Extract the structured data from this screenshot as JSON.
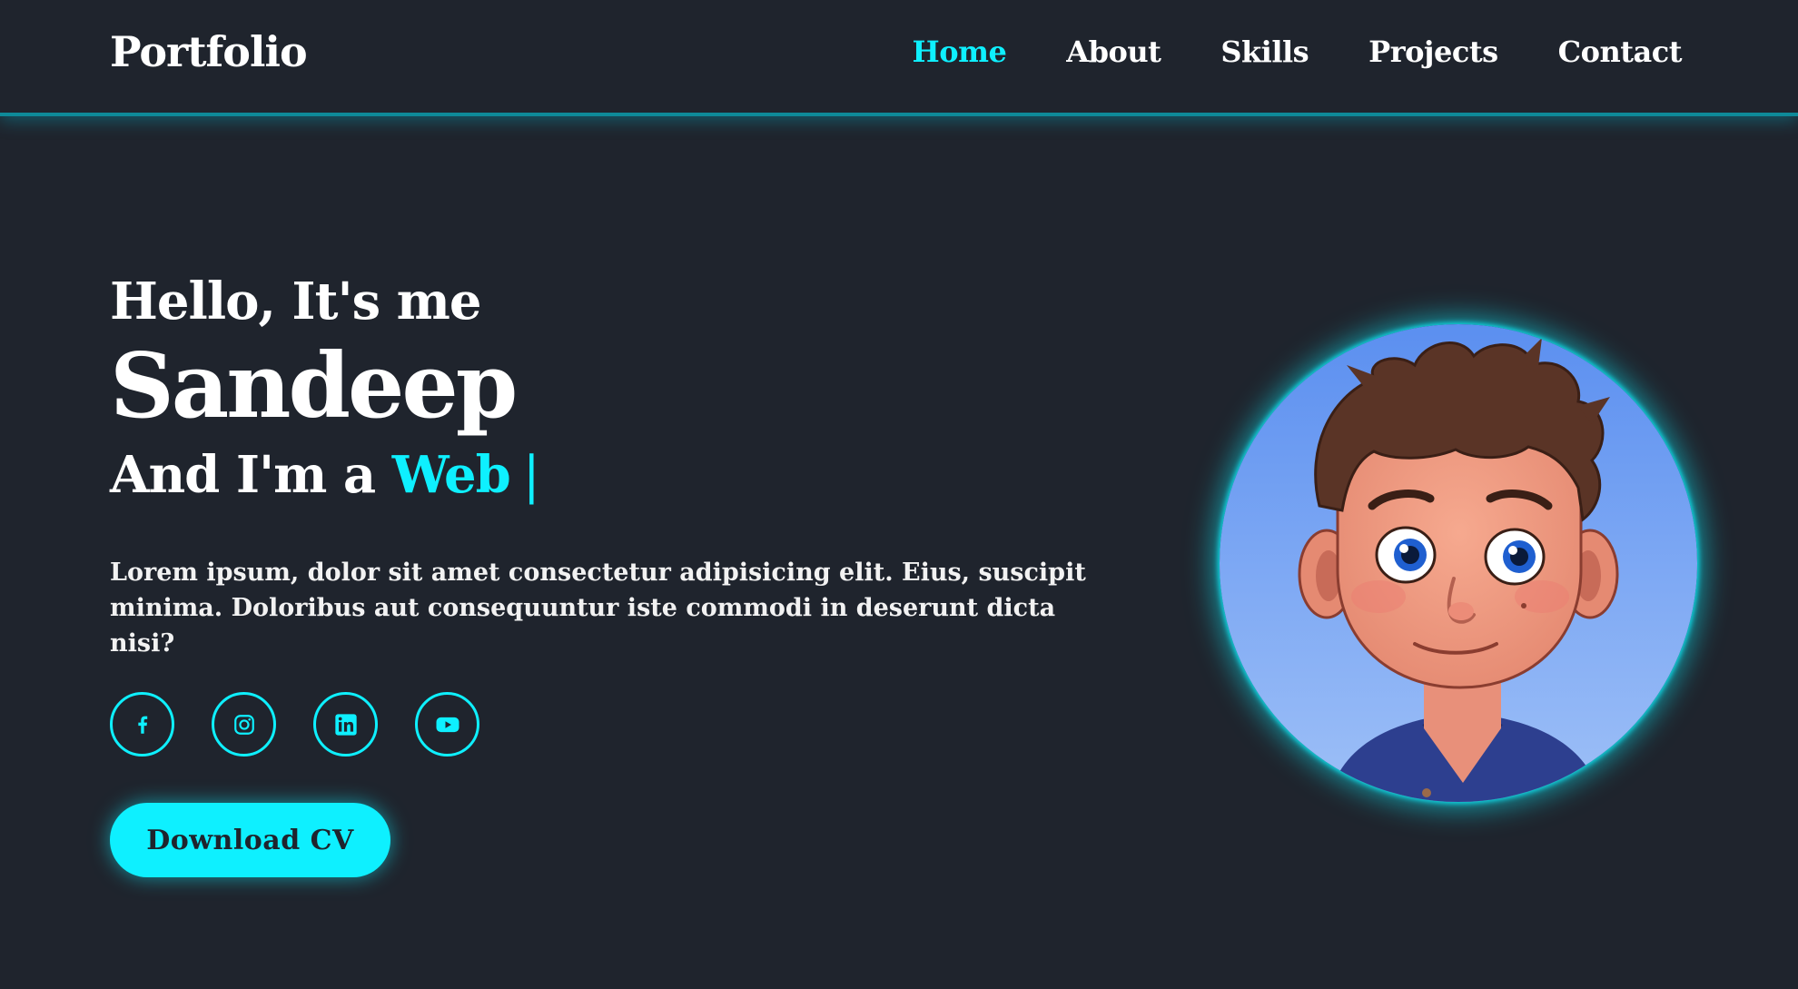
{
  "header": {
    "logo": "Portfolio",
    "nav": [
      {
        "label": "Home",
        "active": true
      },
      {
        "label": "About",
        "active": false
      },
      {
        "label": "Skills",
        "active": false
      },
      {
        "label": "Projects",
        "active": false
      },
      {
        "label": "Contact",
        "active": false
      }
    ]
  },
  "hero": {
    "greeting": "Hello, It's me",
    "name": "Sandeep",
    "role_prefix": "And I'm a",
    "role_accent": "Web",
    "cursor": "|",
    "description": "Lorem ipsum, dolor sit amet consectetur adipisicing elit. Eius, suscipit minima. Doloribus aut consequuntur iste commodi in deserunt dicta nisi?",
    "socials": [
      {
        "icon": "facebook-icon"
      },
      {
        "icon": "instagram-icon"
      },
      {
        "icon": "linkedin-icon"
      },
      {
        "icon": "youtube-icon"
      }
    ],
    "cta_label": "Download CV",
    "avatar": "avatar-illustration"
  },
  "colors": {
    "background": "#1f242d",
    "accent": "#0ef0ff",
    "text": "#ffffff"
  }
}
